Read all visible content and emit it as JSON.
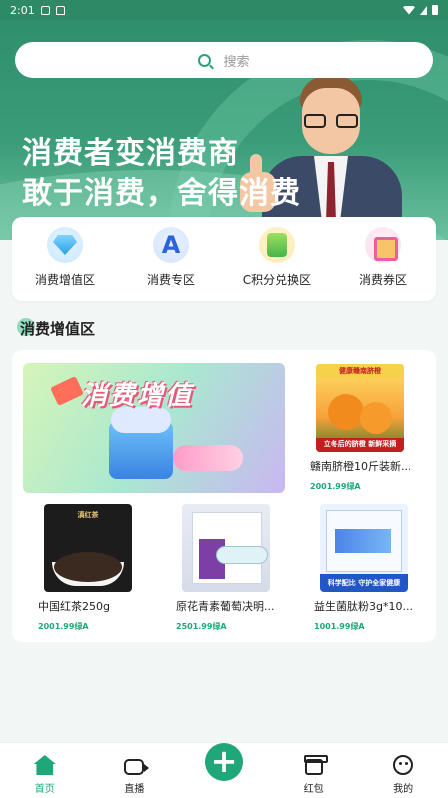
{
  "status_bar": {
    "time": "2:01"
  },
  "search": {
    "placeholder": "搜索"
  },
  "hero": {
    "line1": "消费者变消费商",
    "line2": "敢于消费，舍得消费"
  },
  "categories": [
    {
      "label": "消费增值区",
      "icon": "gem-icon"
    },
    {
      "label": "消费专区",
      "icon": "letter-a-icon"
    },
    {
      "label": "C积分兑换区",
      "icon": "coin-icon"
    },
    {
      "label": "消费券区",
      "icon": "gift-icon"
    }
  ],
  "section": {
    "title": "消费增值区"
  },
  "banner": {
    "text": "消费增值"
  },
  "products": [
    {
      "name": "赣南脐橙10斤装新...",
      "price": "2001.99绿A",
      "img_top": "健康赣南脐橙",
      "img_bottom": "立冬后的脐橙 新鲜采摘"
    },
    {
      "name": "中国红茶250g",
      "price": "2001.99绿A",
      "img_top": "滇红茶"
    },
    {
      "name": "原花青素葡萄决明...",
      "price": "2501.99绿A"
    },
    {
      "name": "益生菌肽粉3g*10...",
      "price": "1001.99绿A",
      "img_bottom": "科学配比 守护全家健康"
    }
  ],
  "nav": [
    {
      "label": "首页",
      "icon": "home-icon",
      "active": true
    },
    {
      "label": "直播",
      "icon": "video-icon"
    },
    {
      "label": "",
      "icon": "plus-icon"
    },
    {
      "label": "红包",
      "icon": "gift-icon"
    },
    {
      "label": "我的",
      "icon": "smile-icon"
    }
  ],
  "colors": {
    "brand": "#1fa77a",
    "hero_bg": "#2f8f6c"
  }
}
